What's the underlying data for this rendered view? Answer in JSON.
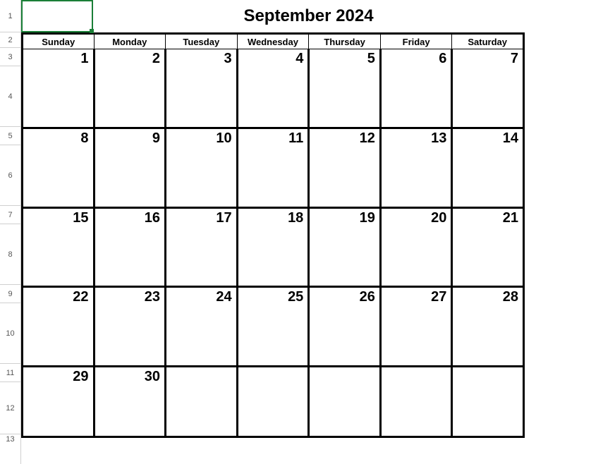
{
  "title": "September 2024",
  "row_headers": [
    "1",
    "2",
    "3",
    "4",
    "5",
    "6",
    "7",
    "8",
    "9",
    "10",
    "11",
    "12",
    "13"
  ],
  "day_headers": [
    "Sunday",
    "Monday",
    "Tuesday",
    "Wednesday",
    "Thursday",
    "Friday",
    "Saturday"
  ],
  "weeks": [
    [
      "1",
      "2",
      "3",
      "4",
      "5",
      "6",
      "7"
    ],
    [
      "8",
      "9",
      "10",
      "11",
      "12",
      "13",
      "14"
    ],
    [
      "15",
      "16",
      "17",
      "18",
      "19",
      "20",
      "21"
    ],
    [
      "22",
      "23",
      "24",
      "25",
      "26",
      "27",
      "28"
    ],
    [
      "29",
      "30",
      "",
      "",
      "",
      "",
      ""
    ]
  ]
}
